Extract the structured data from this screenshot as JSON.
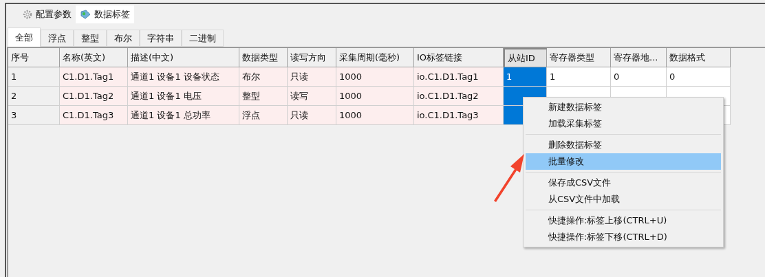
{
  "main_tabs": [
    {
      "label": "配置参数",
      "kind": "settings",
      "selected": false
    },
    {
      "label": "数据标签",
      "kind": "tags",
      "selected": true
    }
  ],
  "sub_tabs": [
    {
      "label": "全部",
      "selected": true
    },
    {
      "label": "浮点",
      "selected": false
    },
    {
      "label": "整型",
      "selected": false
    },
    {
      "label": "布尔",
      "selected": false
    },
    {
      "label": "字符串",
      "selected": false
    },
    {
      "label": "二进制",
      "selected": false
    }
  ],
  "table": {
    "columns": [
      {
        "label": "序号",
        "selected": false
      },
      {
        "label": "名称(英文)",
        "selected": false
      },
      {
        "label": "描述(中文)",
        "selected": false
      },
      {
        "label": "数据类型",
        "selected": false
      },
      {
        "label": "读写方向",
        "selected": false
      },
      {
        "label": "采集周期(毫秒)",
        "selected": false
      },
      {
        "label": "IO标签链接",
        "selected": false
      },
      {
        "label": "从站ID",
        "selected": true
      },
      {
        "label": "寄存器类型",
        "selected": false
      },
      {
        "label": "寄存器地...",
        "selected": false
      },
      {
        "label": "数据格式",
        "selected": false
      }
    ],
    "rows": [
      {
        "cells": [
          "1",
          "C1.D1.Tag1",
          "通道1 设备1 设备状态",
          "布尔",
          "只读",
          "1000",
          "io.C1.D1.Tag1",
          "1",
          "1",
          "0",
          "0"
        ]
      },
      {
        "cells": [
          "2",
          "C1.D1.Tag2",
          "通道1 设备1 电压",
          "整型",
          "读写",
          "1000",
          "io.C1.D1.Tag2"
        ]
      },
      {
        "cells": [
          "3",
          "C1.D1.Tag3",
          "通道1 设备1 总功率",
          "浮点",
          "只读",
          "1000",
          "io.C1.D1.Tag3"
        ]
      }
    ]
  },
  "context_menu": {
    "groups": [
      [
        {
          "label": "新建数据标签",
          "selected": false
        },
        {
          "label": "加载采集标签",
          "selected": false
        }
      ],
      [
        {
          "label": "删除数据标签",
          "selected": false
        },
        {
          "label": "批量修改",
          "selected": true
        }
      ],
      [
        {
          "label": "保存成CSV文件",
          "selected": false
        },
        {
          "label": "从CSV文件中加载",
          "selected": false
        }
      ],
      [
        {
          "label": "快捷操作:标签上移(CTRL+U)",
          "selected": false
        },
        {
          "label": "快捷操作:标签下移(CTRL+D)",
          "selected": false
        }
      ]
    ]
  }
}
